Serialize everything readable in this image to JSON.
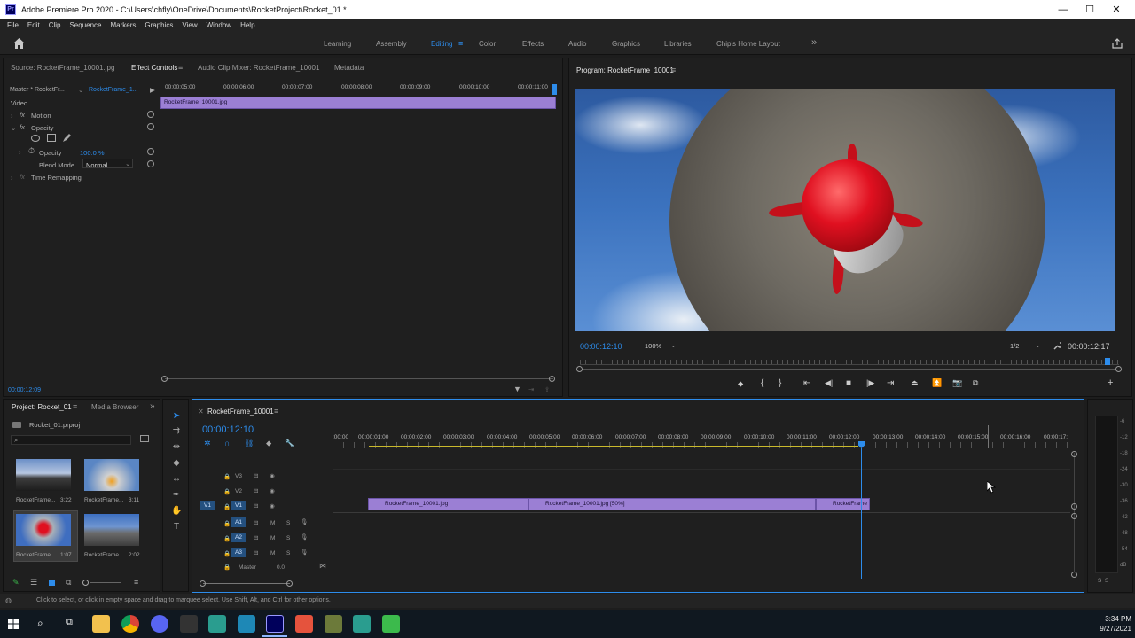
{
  "window": {
    "app_title": "Adobe Premiere Pro 2020 - C:\\Users\\chfly\\OneDrive\\Documents\\RocketProject\\Rocket_01 *",
    "logo_text": "Pr",
    "minimize": "—",
    "maximize": "☐",
    "close": "✕"
  },
  "menu": [
    "File",
    "Edit",
    "Clip",
    "Sequence",
    "Markers",
    "Graphics",
    "View",
    "Window",
    "Help"
  ],
  "workspaces": [
    "Learning",
    "Assembly",
    "Editing",
    "Color",
    "Effects",
    "Audio",
    "Graphics",
    "Libraries",
    "Chip's Home Layout"
  ],
  "workspaces_more": "»",
  "source_panel": {
    "tabs": [
      "Source: RocketFrame_10001.jpg",
      "Effect Controls",
      "Audio Clip Mixer: RocketFrame_10001",
      "Metadata"
    ],
    "master_label": "Master * RocketFr...",
    "clip_label": "RocketFrame_1...",
    "ruler": [
      "00:00:05:00",
      "00:00:06:00",
      "00:00:07:00",
      "00:00:08:00",
      "00:00:09:00",
      "00:00:10:00",
      "00:00:11:00"
    ],
    "clip_bar": "RocketFrame_10001.jpg",
    "section_video": "Video",
    "fx_motion": "Motion",
    "fx_opacity": "Opacity",
    "opacity_label": "Opacity",
    "opacity_value": "100.0 %",
    "blend_label": "Blend Mode",
    "blend_value": "Normal",
    "time_remap": "Time Remapping",
    "timecode": "00:00:12:09"
  },
  "program_panel": {
    "title": "Program: RocketFrame_10001",
    "timecode_current": "00:00:12:10",
    "zoom": "100%",
    "resolution": "1/2",
    "timecode_duration": "00:00:12:17"
  },
  "project_panel": {
    "tabs": [
      "Project: Rocket_01",
      "Media Browser"
    ],
    "project_file": "Rocket_01.prproj",
    "search_placeholder": "",
    "items": [
      {
        "name": "RocketFrame...",
        "duration": "3:22"
      },
      {
        "name": "RocketFrame...",
        "duration": "3:11"
      },
      {
        "name": "RocketFrame...",
        "duration": "1:07"
      },
      {
        "name": "RocketFrame...",
        "duration": "2:02"
      }
    ]
  },
  "timeline": {
    "sequence_tab": "RocketFrame_10001",
    "timecode": "00:00:12:10",
    "ruler": [
      ":00:00",
      "00:00:01:00",
      "00:00:02:00",
      "00:00:03:00",
      "00:00:04:00",
      "00:00:05:00",
      "00:00:06:00",
      "00:00:07:00",
      "00:00:08:00",
      "00:00:09:00",
      "00:00:10:00",
      "00:00:11:00",
      "00:00:12:00",
      "00:00:13:00",
      "00:00:14:00",
      "00:00:15:00",
      "00:00:16:00",
      "00:00:17:"
    ],
    "tracks": {
      "video": [
        "V3",
        "V2",
        "V1"
      ],
      "audio": [
        "A1",
        "A2",
        "A3"
      ],
      "source_v": "V1",
      "mute": "M",
      "solo": "S",
      "master_label": "Master",
      "master_value": "0.0"
    },
    "clips": [
      "RocketFrame_10001.jpg",
      "RocketFrame_10001.jpg [50%]",
      "RocketFrame"
    ]
  },
  "meters": {
    "db_labels": [
      "-6",
      "-12",
      "-18",
      "-24",
      "-30",
      "-36",
      "-42",
      "-48",
      "-54",
      "dB"
    ],
    "solo_buttons": [
      "S",
      "S"
    ]
  },
  "status_text": "Click to select, or click in empty space and drag to marquee select. Use Shift, Alt, and Ctrl for other options.",
  "taskbar": {
    "time": "3:34 PM",
    "date": "9/27/2021"
  },
  "colors": {
    "accent": "#2d8ceb",
    "clip": "#9b7fd4",
    "playhead": "#2d8ceb"
  }
}
